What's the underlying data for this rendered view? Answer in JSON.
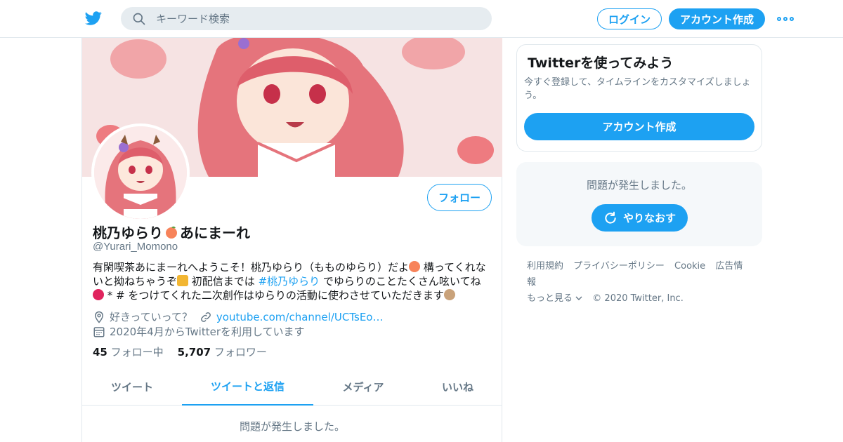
{
  "colors": {
    "accent": "#1da1f2",
    "text": "#14171a",
    "muted": "#657786",
    "border": "#e1e8ed",
    "search_bg": "#e6ecf0"
  },
  "header": {
    "logo_icon": "twitter-bird-icon",
    "search_placeholder": "キーワード検索",
    "login_label": "ログイン",
    "signup_label": "アカウント作成",
    "more_icon": "more-dots-icon"
  },
  "profile": {
    "name_part1": "桃乃ゆらり",
    "name_part2": "あにまーれ",
    "handle": "@Yurari_Momono",
    "follow_label": "フォロー",
    "bio_1": "有閑喫茶あにまーれへようこそ！桃乃ゆらり（もものゆらり）だよ",
    "bio_2": " 構ってくれないと拗ねちゃうぞ",
    "bio_3": " 初配信までは ",
    "bio_hashtag": "#桃乃ゆらり",
    "bio_4": " でゆらりのことたくさん呟いてね",
    "bio_5": " * # をつけてくれた二次創作はゆらりの活動に使わさせていただきます",
    "location": "好きっていって？",
    "url": "youtube.com/channel/UCTsEo…",
    "joined": "2020年4月からTwitterを利用しています",
    "following_count": "45",
    "following_label": "フォロー中",
    "followers_count": "5,707",
    "followers_label": "フォロワー"
  },
  "tabs": [
    {
      "label": "ツイート",
      "active": false
    },
    {
      "label": "ツイートと返信",
      "active": true
    },
    {
      "label": "メディア",
      "active": false
    },
    {
      "label": "いいね",
      "active": false
    }
  ],
  "main_error": "問題が発生しました。",
  "sidebar": {
    "signup_title": "Twitterを使ってみよう",
    "signup_desc": "今すぐ登録して、タイムラインをカスタマイズしましょう。",
    "signup_button": "アカウント作成",
    "error_msg": "問題が発生しました。",
    "retry_label": "やりなおす"
  },
  "footer": {
    "terms": "利用規約",
    "privacy": "プライバシーポリシー",
    "cookie": "Cookie",
    "ads": "広告情報",
    "more": "もっと見る",
    "copyright": "© 2020 Twitter, Inc."
  }
}
